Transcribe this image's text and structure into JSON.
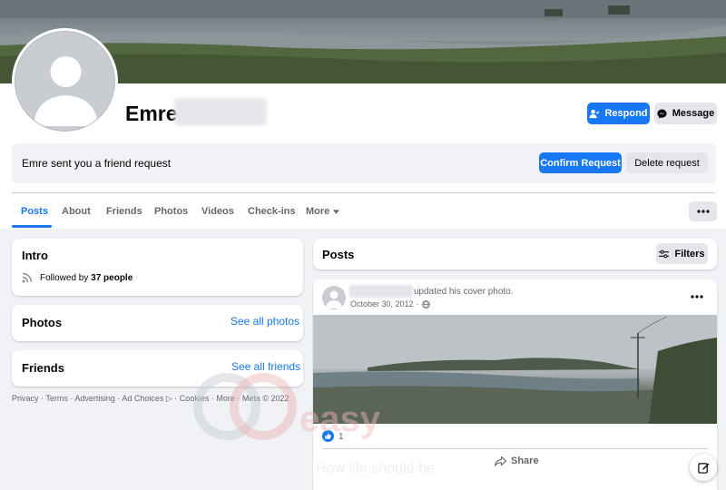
{
  "profile": {
    "name": "Emre"
  },
  "actions": {
    "respond_label": "Respond",
    "message_label": "Message"
  },
  "friend_request": {
    "text": "Emre sent you a friend request",
    "confirm_label": "Confirm Request",
    "delete_label": "Delete request"
  },
  "tabs": [
    {
      "label": "Posts",
      "active": true
    },
    {
      "label": "About"
    },
    {
      "label": "Friends"
    },
    {
      "label": "Photos"
    },
    {
      "label": "Videos"
    },
    {
      "label": "Check-ins"
    },
    {
      "label": "More"
    }
  ],
  "intro": {
    "title": "Intro",
    "followed_prefix": "Followed by ",
    "followed_count": "37 people"
  },
  "photos": {
    "title": "Photos",
    "see_all": "See all photos"
  },
  "friends": {
    "title": "Friends",
    "see_all": "See all friends"
  },
  "footer": {
    "text": "Privacy · Terms · Advertising · Ad Choices ▷ · Cookies · More · Meta © 2022"
  },
  "posts_header": {
    "title": "Posts",
    "filters_label": "Filters"
  },
  "post": {
    "action_text": "updated his cover photo.",
    "date": "October 30, 2012",
    "reaction_count": "1",
    "share_label": "Share"
  },
  "watermark": {
    "brand": "easy",
    "tagline": "How life should be"
  },
  "colors": {
    "accent": "#1877f2",
    "page_bg": "#f0f2f5",
    "secondary_button": "#e4e6eb"
  }
}
